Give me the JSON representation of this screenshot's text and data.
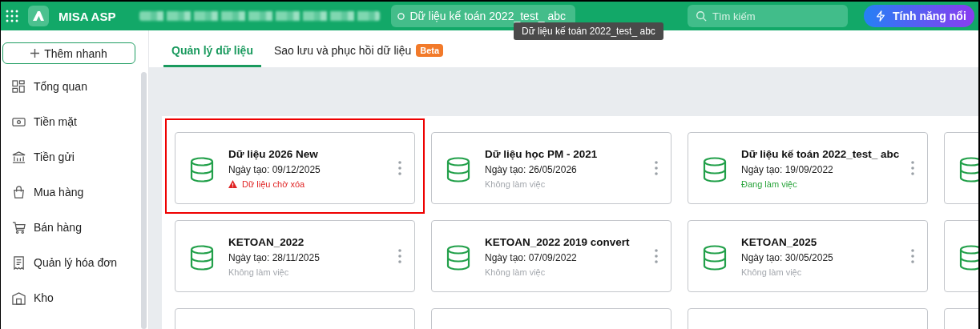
{
  "header": {
    "app_name": "MISA ASP",
    "database_pill": "Dữ liệu kế toán 2022_test_ abc",
    "search": {
      "placeholder": "Tìm kiếm"
    },
    "feature_button": "Tính năng nổi",
    "tooltip": "Dữ liệu kế toán 2022_test_ abc"
  },
  "sidebar": {
    "quick_add": "Thêm nhanh",
    "items": [
      {
        "label": "Tổng quan"
      },
      {
        "label": "Tiền mặt"
      },
      {
        "label": "Tiền gửi"
      },
      {
        "label": "Mua hàng"
      },
      {
        "label": "Bán hàng"
      },
      {
        "label": "Quản lý hóa đơn"
      },
      {
        "label": "Kho"
      }
    ]
  },
  "tabs": [
    {
      "label": "Quản lý dữ liệu",
      "selected": true
    },
    {
      "label": "Sao lưu và phục hồi dữ liệu",
      "selected": false,
      "badge": "Beta"
    }
  ],
  "cards": [
    {
      "kind": "full",
      "title": "Dữ liệu 2026 New",
      "date": "Ngày tạo: 09/12/2025",
      "status": {
        "kind": "pending_delete",
        "text": "Dữ liệu chờ xóa"
      },
      "highlighted": true
    },
    {
      "kind": "full",
      "title": "Dữ liệu học PM - 2021",
      "date": "Ngày tạo: 26/05/2026",
      "status": {
        "kind": "idle",
        "text": "Không làm việc"
      },
      "highlighted": false
    },
    {
      "kind": "full",
      "title": "Dữ liệu kế toán 2022_test_ abc",
      "date": "Ngày tạo: 19/09/2022",
      "status": {
        "kind": "active",
        "text": "Đang làm việc"
      },
      "highlighted": false
    },
    {
      "kind": "cut",
      "highlighted": false
    },
    {
      "kind": "full",
      "title": "KETOAN_2022",
      "date": "Ngày tạo: 28/11/2025",
      "status": {
        "kind": "idle",
        "text": "Không làm việc"
      },
      "highlighted": false
    },
    {
      "kind": "full",
      "title": "KETOAN_2022 2019 convert",
      "date": "Ngày tạo: 07/09/2022",
      "status": {
        "kind": "idle",
        "text": "Không làm việc"
      },
      "highlighted": false
    },
    {
      "kind": "full",
      "title": "KETOAN_2025",
      "date": "Ngày tạo: 30/05/2025",
      "status": {
        "kind": "idle",
        "text": "Không làm việc"
      },
      "highlighted": false
    },
    {
      "kind": "cut",
      "highlighted": false
    },
    {
      "kind": "cut",
      "highlighted": false
    },
    {
      "kind": "cut",
      "highlighted": false
    },
    {
      "kind": "cut",
      "highlighted": false
    },
    {
      "kind": "cut",
      "highlighted": false
    }
  ]
}
